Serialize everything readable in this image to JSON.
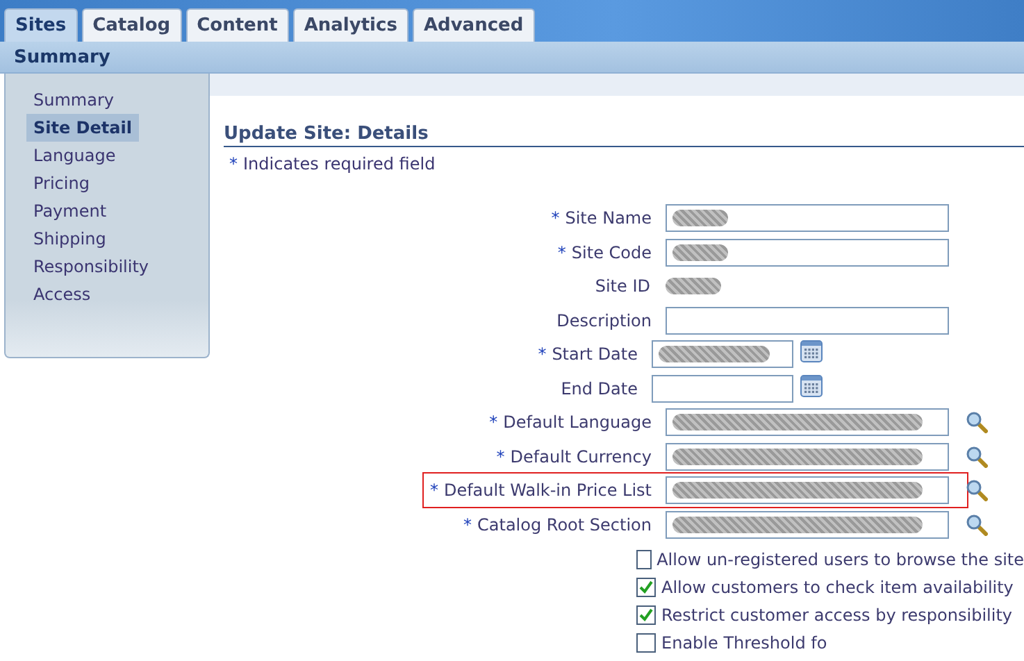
{
  "tabs": [
    {
      "label": "Sites",
      "selected": true
    },
    {
      "label": "Catalog",
      "selected": false
    },
    {
      "label": "Content",
      "selected": false
    },
    {
      "label": "Analytics",
      "selected": false
    },
    {
      "label": "Advanced",
      "selected": false
    }
  ],
  "subtab": {
    "label": "Summary"
  },
  "sidebar": {
    "items": [
      {
        "label": "Summary",
        "selected": false
      },
      {
        "label": "Site Detail",
        "selected": true
      },
      {
        "label": "Language",
        "selected": false
      },
      {
        "label": "Pricing",
        "selected": false
      },
      {
        "label": "Payment",
        "selected": false
      },
      {
        "label": "Shipping",
        "selected": false
      },
      {
        "label": "Responsibility",
        "selected": false
      },
      {
        "label": "Access",
        "selected": false
      }
    ]
  },
  "page": {
    "title": "Update Site: Details",
    "required_note": "Indicates required field",
    "required_mark": "*"
  },
  "fields": [
    {
      "label": "Site Name",
      "kind": "text",
      "required": true,
      "redacted": true,
      "highlighted": false
    },
    {
      "label": "Site Code",
      "kind": "text",
      "required": true,
      "redacted": true,
      "highlighted": false
    },
    {
      "label": "Site ID",
      "kind": "display",
      "required": false,
      "redacted": true,
      "highlighted": false
    },
    {
      "label": "Description",
      "kind": "text",
      "required": false,
      "redacted": false,
      "highlighted": false
    },
    {
      "label": "Start Date",
      "kind": "date",
      "required": true,
      "redacted": true,
      "highlighted": false
    },
    {
      "label": "End Date",
      "kind": "date",
      "required": false,
      "redacted": false,
      "highlighted": false
    },
    {
      "label": "Default Language",
      "kind": "lov",
      "required": true,
      "redacted": true,
      "highlighted": false
    },
    {
      "label": "Default Currency",
      "kind": "lov",
      "required": true,
      "redacted": true,
      "highlighted": false
    },
    {
      "label": "Default Walk-in Price List",
      "kind": "lov",
      "required": true,
      "redacted": true,
      "highlighted": true
    },
    {
      "label": "Catalog Root Section",
      "kind": "lov",
      "required": true,
      "redacted": true,
      "highlighted": false
    }
  ],
  "options": [
    {
      "label": "Allow un-registered users to browse the site",
      "checked": false
    },
    {
      "label": "Allow customers to check item availability",
      "checked": true
    },
    {
      "label": "Restrict customer access by responsibility",
      "checked": true
    },
    {
      "label": "Enable Threshold fo",
      "checked": false
    }
  ]
}
